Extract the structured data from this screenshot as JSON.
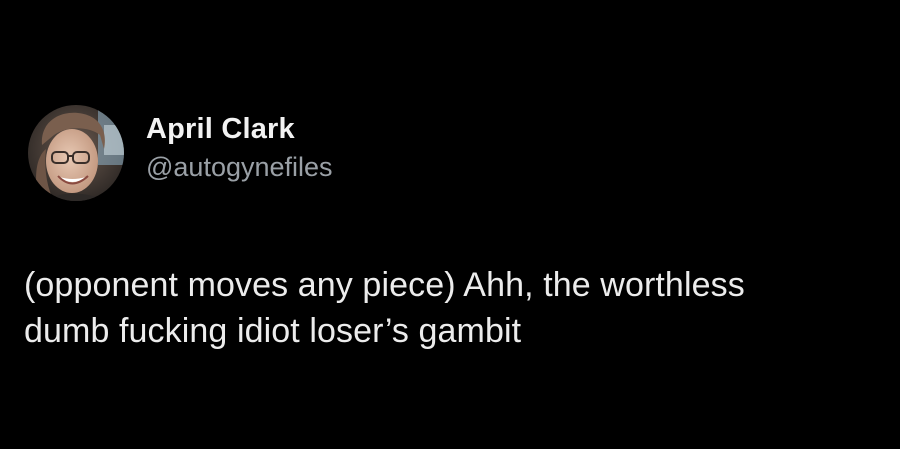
{
  "tweet": {
    "author": {
      "display_name": "April Clark",
      "handle": "@autogynefiles",
      "avatar_icon": "profile-photo"
    },
    "text_lines": [
      "(opponent moves any piece) Ahh, the worthless",
      "dumb fucking idiot loser’s gambit"
    ]
  },
  "colors": {
    "background": "#000000",
    "name_text": "#f2f2f2",
    "handle_text": "#9aa0a6",
    "body_text": "#ececec"
  }
}
